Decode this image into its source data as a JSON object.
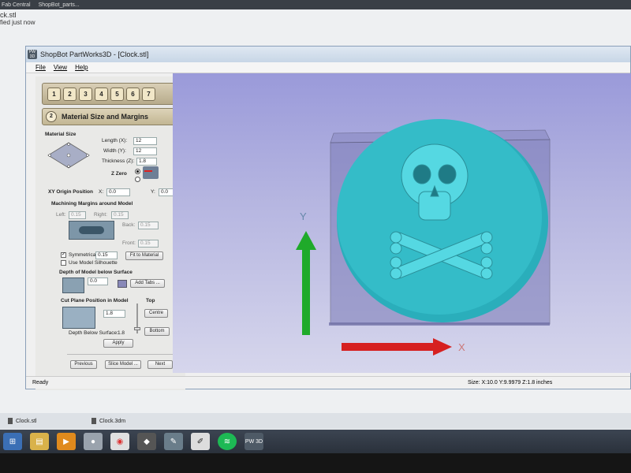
{
  "browser": {
    "tabs": [
      "Fab Central",
      "ShopBot_parts..."
    ],
    "notification_title": "ck.stl",
    "notification_subtitle": "fied just now"
  },
  "window": {
    "app_icon_text": "PW 3D",
    "title": "ShopBot PartWorks3D - [Clock.stl]"
  },
  "menu": [
    "File",
    "View",
    "Help"
  ],
  "stepbar": {
    "steps": [
      "1",
      "2",
      "3",
      "4",
      "5",
      "6",
      "7"
    ]
  },
  "panel": {
    "heading_number": "2",
    "heading": "Material Size and Margins",
    "material_size_label": "Material Size",
    "length_label": "Length (X):",
    "length_value": "12",
    "width_label": "Width (Y):",
    "width_value": "12",
    "thickness_label": "Thickness (Z):",
    "thickness_value": "1.8",
    "zzero_label": "Z Zero",
    "origin_label": "XY Origin Position",
    "origin_x_label": "X:",
    "origin_x_value": "0.0",
    "origin_y_label": "Y:",
    "origin_y_value": "0.0",
    "margins_heading": "Machining Margins around Model",
    "left_label": "Left:",
    "left_value": "0.15",
    "right_label": "Right:",
    "right_value": "0.15",
    "back_label": "Back:",
    "back_value": "0.15",
    "front_label": "Front:",
    "front_value": "0.15",
    "symmetrical_label": "Symmetrical",
    "symmetrical_value": "0.15",
    "symmetrical_checked": true,
    "silhouette_label": "Use Model Silhouette",
    "fit_button": "Fit to Material",
    "depth_heading": "Depth of Model below Surface",
    "depth_value": "0.0",
    "add_tabs_button": "Add Tabs ...",
    "cut_plane_heading": "Cut Plane Position in Model",
    "top_label": "Top",
    "cut_plane_value": "1.8",
    "centre_button": "Centre",
    "bottom_button": "Bottom",
    "depth_below_label": "Depth Below Surface:",
    "depth_below_value": "1.8",
    "apply_button": "Apply",
    "previous_button": "Previous",
    "slice_button": "Slice Model ...",
    "next_button": "Next"
  },
  "viewport": {
    "y_axis_label": "Y",
    "x_axis_label": "X",
    "colors": {
      "background_top": "#9a9ada",
      "disc": "#2fb8c4",
      "disc_raised": "#4fd7e0",
      "block": "#7878a8",
      "y_arrow": "#1faa2a",
      "x_arrow": "#d62020"
    }
  },
  "status": {
    "left": "Ready",
    "right": "Size: X:10.0 Y:9.9979 Z:1.8 inches"
  },
  "taskpanel": {
    "items": [
      "Clock.stl",
      "Clock.3dm"
    ]
  },
  "taskbar": {
    "icons": [
      "windows-icon",
      "file-explorer-icon",
      "media-player-icon",
      "app-icon",
      "chrome-icon",
      "inkscape-icon",
      "paint-icon",
      "sketch-icon",
      "spotify-icon",
      "partworks3d-icon"
    ],
    "pw3d_text": "PW 3D"
  }
}
